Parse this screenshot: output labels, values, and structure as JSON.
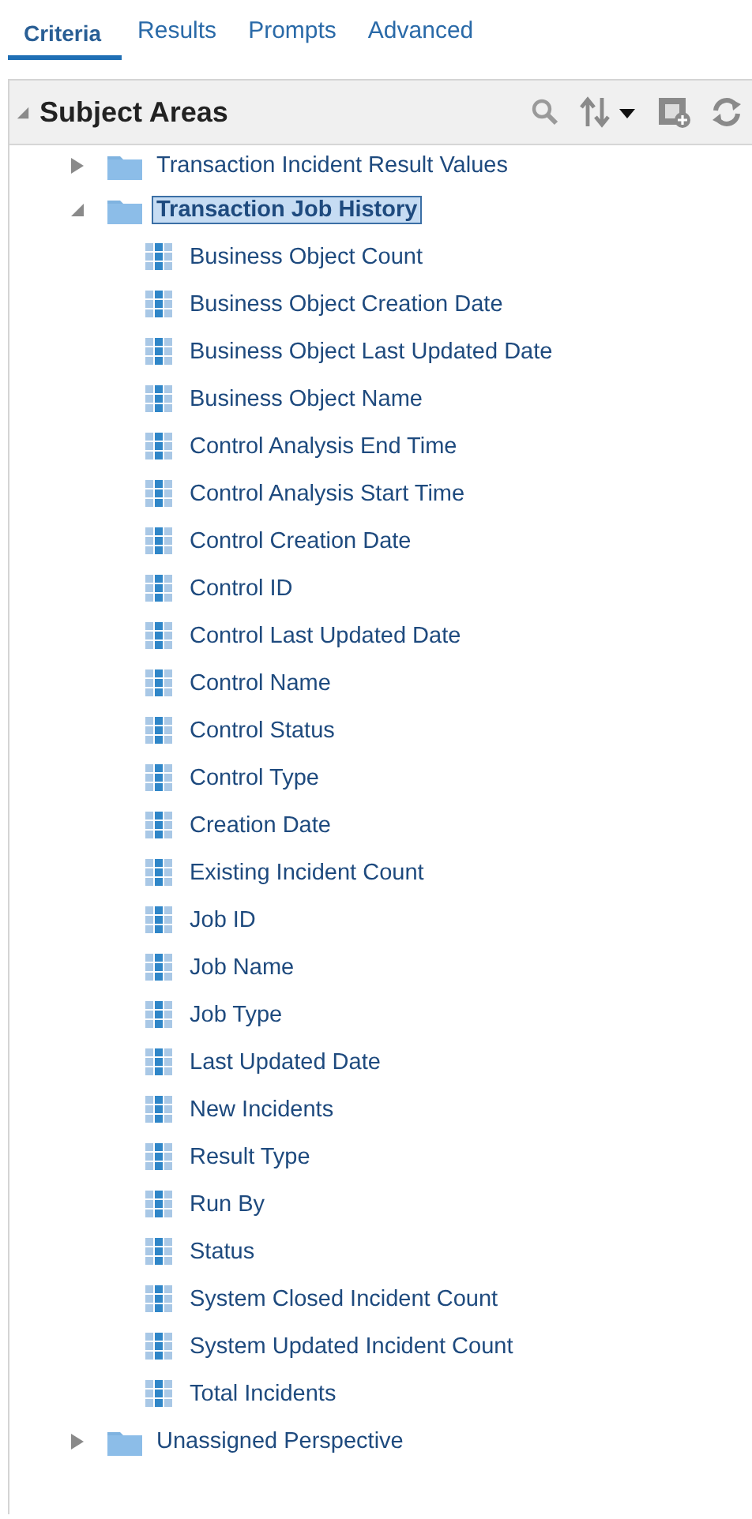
{
  "tabs": [
    {
      "label": "Criteria",
      "selected": true
    },
    {
      "label": "Results",
      "selected": false
    },
    {
      "label": "Prompts",
      "selected": false
    },
    {
      "label": "Advanced",
      "selected": false
    }
  ],
  "panel": {
    "title": "Subject Areas",
    "expanded": true
  },
  "tree": [
    {
      "label": "Transaction Incident Result Values",
      "expanded": false,
      "selected": false
    },
    {
      "label": "Transaction Job History",
      "expanded": true,
      "selected": true,
      "children": [
        {
          "label": "Business Object Count"
        },
        {
          "label": "Business Object Creation Date"
        },
        {
          "label": "Business Object Last Updated Date"
        },
        {
          "label": "Business Object Name"
        },
        {
          "label": "Control Analysis End Time"
        },
        {
          "label": "Control Analysis Start Time"
        },
        {
          "label": "Control Creation Date"
        },
        {
          "label": "Control ID"
        },
        {
          "label": "Control Last Updated Date"
        },
        {
          "label": "Control Name"
        },
        {
          "label": "Control Status"
        },
        {
          "label": "Control Type"
        },
        {
          "label": "Creation Date"
        },
        {
          "label": "Existing Incident Count"
        },
        {
          "label": "Job ID"
        },
        {
          "label": "Job Name"
        },
        {
          "label": "Job Type"
        },
        {
          "label": "Last Updated Date"
        },
        {
          "label": "New Incidents"
        },
        {
          "label": "Result Type"
        },
        {
          "label": "Run By"
        },
        {
          "label": "Status"
        },
        {
          "label": "System Closed Incident Count"
        },
        {
          "label": "System Updated Incident Count"
        },
        {
          "label": "Total Incidents"
        }
      ]
    },
    {
      "label": "Unassigned Perspective",
      "expanded": false,
      "selected": false
    }
  ]
}
